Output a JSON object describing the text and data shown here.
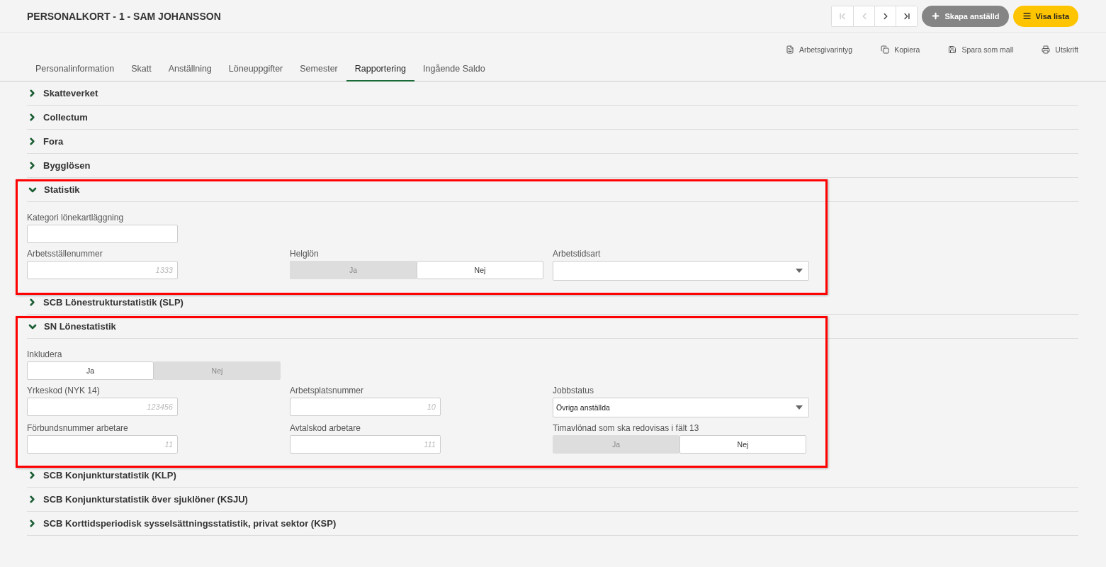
{
  "header": {
    "title": "PERSONALKORT - 1 - SAM JOHANSSON",
    "nav": [
      {
        "kind": "first",
        "disabled": true
      },
      {
        "kind": "prev",
        "disabled": true
      },
      {
        "kind": "next",
        "disabled": false
      },
      {
        "kind": "last",
        "disabled": false
      }
    ],
    "create_button": "Skapa anställd",
    "list_button": "Visa lista"
  },
  "actions": [
    {
      "kind": "document",
      "label": "Arbetsgivarintyg"
    },
    {
      "kind": "copy",
      "label": "Kopiera"
    },
    {
      "kind": "save",
      "label": "Spara som mall"
    },
    {
      "kind": "print",
      "label": "Utskrift"
    }
  ],
  "tabs": [
    {
      "label": "Personalinformation",
      "selected": false
    },
    {
      "label": "Skatt",
      "selected": false
    },
    {
      "label": "Anställning",
      "selected": false
    },
    {
      "label": "Löneuppgifter",
      "selected": false
    },
    {
      "label": "Semester",
      "selected": false
    },
    {
      "label": "Rapportering",
      "selected": true
    },
    {
      "label": "Ingående Saldo",
      "selected": false
    }
  ],
  "sections": [
    {
      "title": "Skatteverket",
      "expanded": false,
      "highlighted": false
    },
    {
      "title": "Collectum",
      "expanded": false,
      "highlighted": false
    },
    {
      "title": "Fora",
      "expanded": false,
      "highlighted": false
    },
    {
      "title": "Bygglösen",
      "expanded": false,
      "highlighted": false
    },
    {
      "title": "Statistik",
      "expanded": true,
      "highlighted": true,
      "rows": [
        [
          {
            "kind": "text",
            "label": "Kategori lönekartläggning"
          }
        ],
        [
          {
            "kind": "text",
            "label": "Arbetsställenummer",
            "placeholder": "1333"
          },
          {
            "kind": "toggle",
            "label": "Helglön",
            "options": [
              {
                "label": "Ja",
                "selected": false
              },
              {
                "label": "Nej",
                "selected": true
              }
            ]
          },
          {
            "kind": "select",
            "label": "Arbetstidsart"
          }
        ]
      ]
    },
    {
      "title": "SCB Lönestrukturstatistik (SLP)",
      "expanded": false,
      "highlighted": false
    },
    {
      "title": "SN Lönestatistik",
      "expanded": true,
      "highlighted": true,
      "rows": [
        [
          {
            "kind": "toggle",
            "label": "Inkludera",
            "options": [
              {
                "label": "Ja",
                "selected": true
              },
              {
                "label": "Nej",
                "selected": false
              }
            ]
          }
        ],
        [
          {
            "kind": "text",
            "label": "Yrkeskod (NYK 14)",
            "placeholder": "123456"
          },
          {
            "kind": "text",
            "label": "Arbetsplatsnummer",
            "placeholder": "10"
          },
          {
            "kind": "select",
            "label": "Jobbstatus",
            "value": "Övriga anställda"
          }
        ],
        [
          {
            "kind": "text",
            "label": "Förbundsnummer arbetare",
            "placeholder": "11"
          },
          {
            "kind": "text",
            "label": "Avtalskod arbetare",
            "placeholder": "111"
          },
          {
            "kind": "toggle",
            "label": "Timavlönad som ska redovisas i fält 13",
            "options": [
              {
                "label": "Ja",
                "selected": false
              },
              {
                "label": "Nej",
                "selected": true
              }
            ]
          }
        ]
      ]
    },
    {
      "title": "SCB Konjunkturstatistik (KLP)",
      "expanded": false,
      "highlighted": false
    },
    {
      "title": "SCB Konjunkturstatistik över sjuklöner (KSJU)",
      "expanded": false,
      "highlighted": false
    },
    {
      "title": "SCB Korttidsperiodisk sysselsättningsstatistik, privat sektor (KSP)",
      "expanded": false,
      "highlighted": false
    }
  ]
}
